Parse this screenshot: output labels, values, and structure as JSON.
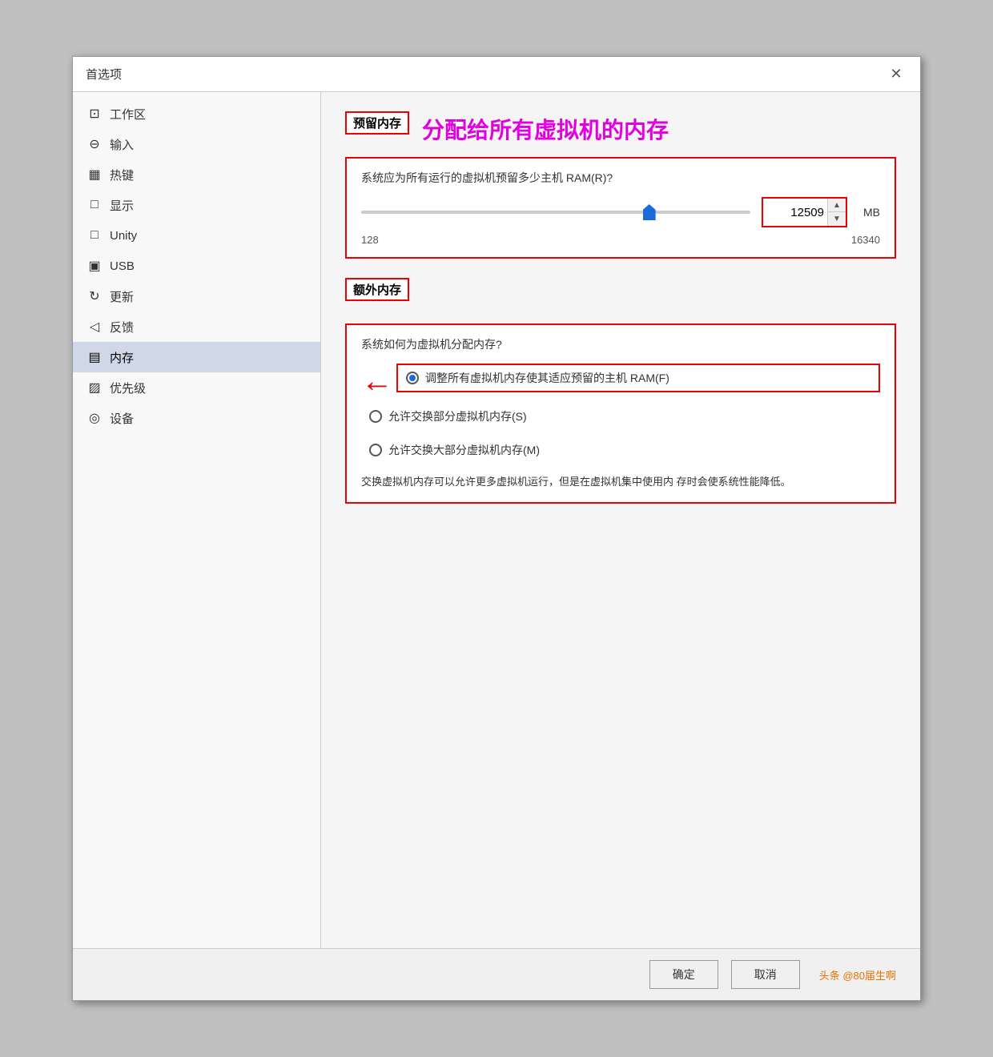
{
  "dialog": {
    "title": "首选项",
    "close_label": "✕"
  },
  "sidebar": {
    "items": [
      {
        "id": "workspace",
        "icon": "⊡",
        "label": "工作区"
      },
      {
        "id": "input",
        "icon": "⊖",
        "label": "输入"
      },
      {
        "id": "hotkey",
        "icon": "▦",
        "label": "热键"
      },
      {
        "id": "display",
        "icon": "□",
        "label": "显示"
      },
      {
        "id": "unity",
        "icon": "□",
        "label": "Unity"
      },
      {
        "id": "usb",
        "icon": "▣",
        "label": "USB"
      },
      {
        "id": "update",
        "icon": "↻",
        "label": "更新"
      },
      {
        "id": "feedback",
        "icon": "◁",
        "label": "反馈"
      },
      {
        "id": "memory",
        "icon": "▤",
        "label": "内存",
        "active": true
      },
      {
        "id": "priority",
        "icon": "▨",
        "label": "优先级"
      },
      {
        "id": "device",
        "icon": "◎",
        "label": "设备"
      }
    ]
  },
  "main": {
    "reserved_memory": {
      "section_label": "预留内存",
      "annotation": "分配给所有虚拟机的内存",
      "desc": "系统应为所有运行的虚拟机预留多少主机 RAM(R)?",
      "slider_value": 74,
      "spinbox_value": "12509",
      "unit": "MB",
      "range_min": "128",
      "range_max": "16340"
    },
    "extra_memory": {
      "section_label": "额外内存",
      "desc": "系统如何为虚拟机分配内存?",
      "options": [
        {
          "id": "fit",
          "label": "调整所有虚拟机内存使其适应预留的主机 RAM(F)",
          "checked": true,
          "highlighted": true
        },
        {
          "id": "swap_partial",
          "label": "允许交换部分虚拟机内存(S)",
          "checked": false
        },
        {
          "id": "swap_most",
          "label": "允许交换大部分虚拟机内存(M)",
          "checked": false
        }
      ],
      "note": "交换虚拟机内存可以允许更多虚拟机运行，但是在虚拟机集中使用内\n存时会使系统性能降低。"
    }
  },
  "footer": {
    "ok_label": "确定",
    "cancel_label": "取消",
    "watermark": "头条 @80届生啊"
  }
}
